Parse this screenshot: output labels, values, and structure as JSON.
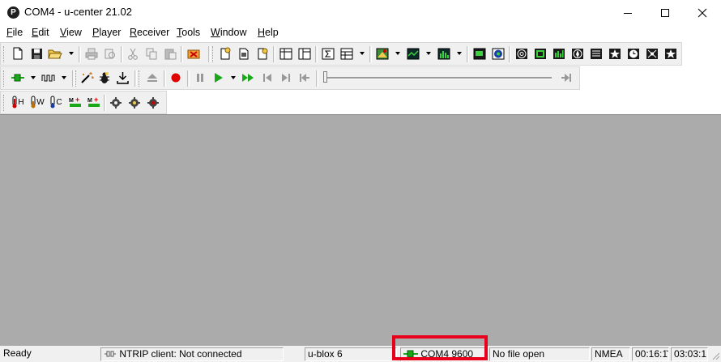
{
  "window": {
    "logo_letter": "P",
    "title": "COM4 - u-center 21.02"
  },
  "menu": [
    "File",
    "Edit",
    "View",
    "Player",
    "Receiver",
    "Tools",
    "Window",
    "Help"
  ],
  "toolbar_row3_labels": {
    "hotstart": "H",
    "warmstart": "W",
    "coldstart": "C"
  },
  "statusbar": {
    "ready": "Ready",
    "ntrip": "NTRIP client: Not connected",
    "receiver": "u-blox 6",
    "port": "COM4 9600",
    "file": "No file open",
    "protocol": "NMEA",
    "time1": "00:16:1̆",
    "time2": "03:03:1"
  },
  "colors": {
    "highlight": "#e8001c",
    "workspace": "#ababab",
    "record": "#e00000",
    "play": "#1aa81a"
  }
}
